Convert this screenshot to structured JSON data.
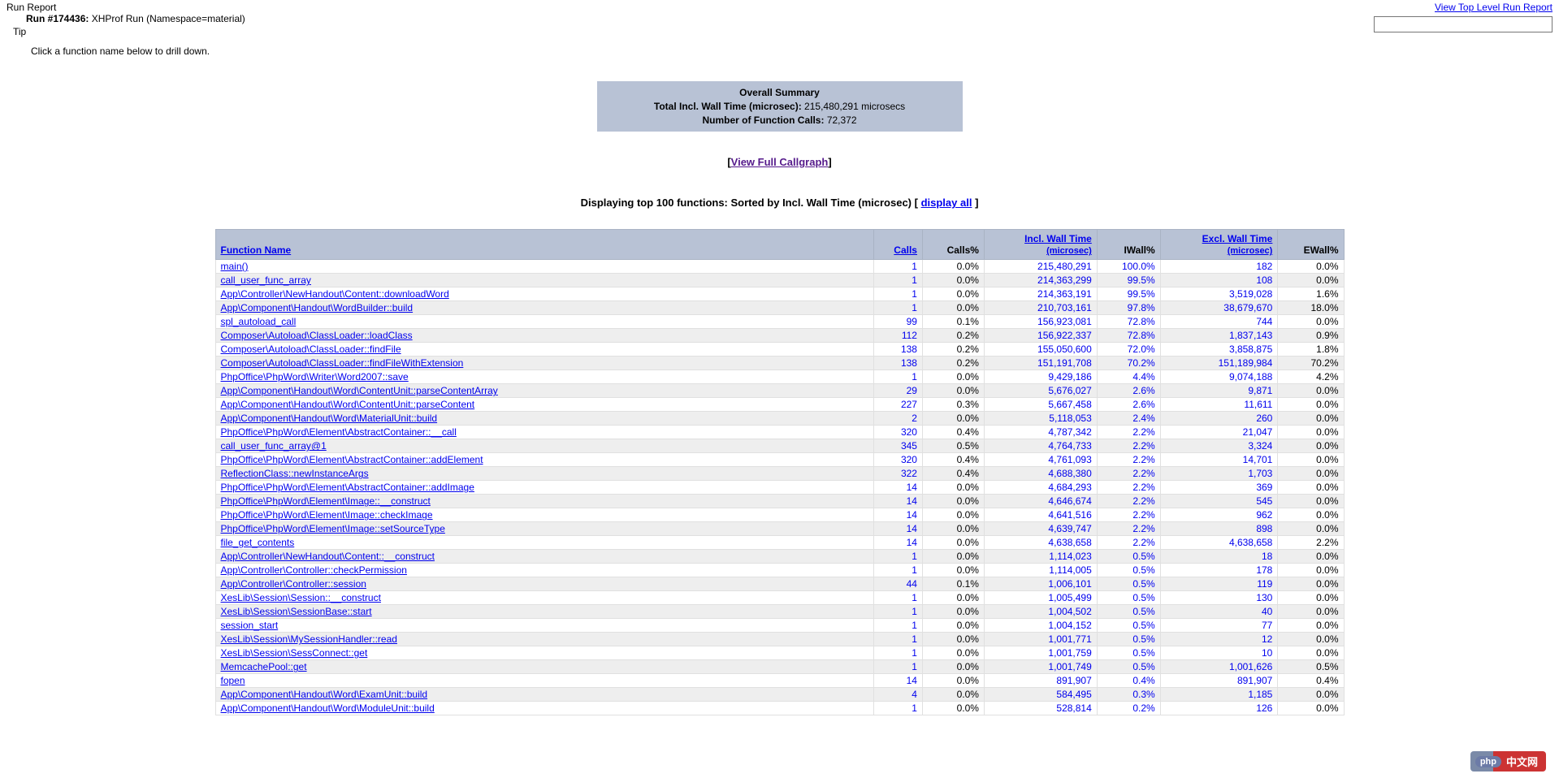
{
  "header": {
    "report_label": "Run Report",
    "run_prefix": "Run #174436:",
    "run_desc": "XHProf Run (Namespace=material)",
    "tip_label": "Tip",
    "tip_text": "Click a function name below to drill down.",
    "top_link": "View Top Level Run Report"
  },
  "summary": {
    "title": "Overall Summary",
    "line1_label": "Total Incl. Wall Time (microsec):",
    "line1_value": "215,480,291 microsecs",
    "line2_label": "Number of Function Calls:",
    "line2_value": "72,372"
  },
  "callgraph": {
    "open": "[",
    "text": "View Full Callgraph",
    "close": "]"
  },
  "heading": {
    "text": "Displaying top 100 functions: Sorted by Incl. Wall Time (microsec)",
    "link_open": " [ ",
    "link_text": "display all",
    "link_close": " ]"
  },
  "columns": {
    "fname": "Function Name",
    "calls": "Calls",
    "calls_pct": "Calls%",
    "iwt": "Incl. Wall Time",
    "iwt_sub": "(microsec)",
    "iwall_pct": "IWall%",
    "ewt": "Excl. Wall Time",
    "ewt_sub": "(microsec)",
    "ewall_pct": "EWall%"
  },
  "rows": [
    {
      "fn": "main()",
      "calls": "1",
      "calls_pct": "0.0%",
      "iwt": "215,480,291",
      "iwall": "100.0%",
      "ewt": "182",
      "ewall": "0.0%"
    },
    {
      "fn": "call_user_func_array",
      "calls": "1",
      "calls_pct": "0.0%",
      "iwt": "214,363,299",
      "iwall": "99.5%",
      "ewt": "108",
      "ewall": "0.0%"
    },
    {
      "fn": "App\\Controller\\NewHandout\\Content::downloadWord",
      "calls": "1",
      "calls_pct": "0.0%",
      "iwt": "214,363,191",
      "iwall": "99.5%",
      "ewt": "3,519,028",
      "ewall": "1.6%"
    },
    {
      "fn": "App\\Component\\Handout\\WordBuilder::build",
      "calls": "1",
      "calls_pct": "0.0%",
      "iwt": "210,703,161",
      "iwall": "97.8%",
      "ewt": "38,679,670",
      "ewall": "18.0%"
    },
    {
      "fn": "spl_autoload_call",
      "calls": "99",
      "calls_pct": "0.1%",
      "iwt": "156,923,081",
      "iwall": "72.8%",
      "ewt": "744",
      "ewall": "0.0%"
    },
    {
      "fn": "Composer\\Autoload\\ClassLoader::loadClass",
      "calls": "112",
      "calls_pct": "0.2%",
      "iwt": "156,922,337",
      "iwall": "72.8%",
      "ewt": "1,837,143",
      "ewall": "0.9%"
    },
    {
      "fn": "Composer\\Autoload\\ClassLoader::findFile",
      "calls": "138",
      "calls_pct": "0.2%",
      "iwt": "155,050,600",
      "iwall": "72.0%",
      "ewt": "3,858,875",
      "ewall": "1.8%"
    },
    {
      "fn": "Composer\\Autoload\\ClassLoader::findFileWithExtension",
      "calls": "138",
      "calls_pct": "0.2%",
      "iwt": "151,191,708",
      "iwall": "70.2%",
      "ewt": "151,189,984",
      "ewall": "70.2%"
    },
    {
      "fn": "PhpOffice\\PhpWord\\Writer\\Word2007::save",
      "calls": "1",
      "calls_pct": "0.0%",
      "iwt": "9,429,186",
      "iwall": "4.4%",
      "ewt": "9,074,188",
      "ewall": "4.2%"
    },
    {
      "fn": "App\\Component\\Handout\\Word\\ContentUnit::parseContentArray",
      "calls": "29",
      "calls_pct": "0.0%",
      "iwt": "5,676,027",
      "iwall": "2.6%",
      "ewt": "9,871",
      "ewall": "0.0%"
    },
    {
      "fn": "App\\Component\\Handout\\Word\\ContentUnit::parseContent",
      "calls": "227",
      "calls_pct": "0.3%",
      "iwt": "5,667,458",
      "iwall": "2.6%",
      "ewt": "11,611",
      "ewall": "0.0%"
    },
    {
      "fn": "App\\Component\\Handout\\Word\\MaterialUnit::build",
      "calls": "2",
      "calls_pct": "0.0%",
      "iwt": "5,118,053",
      "iwall": "2.4%",
      "ewt": "260",
      "ewall": "0.0%"
    },
    {
      "fn": "PhpOffice\\PhpWord\\Element\\AbstractContainer::__call",
      "calls": "320",
      "calls_pct": "0.4%",
      "iwt": "4,787,342",
      "iwall": "2.2%",
      "ewt": "21,047",
      "ewall": "0.0%"
    },
    {
      "fn": "call_user_func_array@1",
      "calls": "345",
      "calls_pct": "0.5%",
      "iwt": "4,764,733",
      "iwall": "2.2%",
      "ewt": "3,324",
      "ewall": "0.0%"
    },
    {
      "fn": "PhpOffice\\PhpWord\\Element\\AbstractContainer::addElement",
      "calls": "320",
      "calls_pct": "0.4%",
      "iwt": "4,761,093",
      "iwall": "2.2%",
      "ewt": "14,701",
      "ewall": "0.0%"
    },
    {
      "fn": "ReflectionClass::newInstanceArgs",
      "calls": "322",
      "calls_pct": "0.4%",
      "iwt": "4,688,380",
      "iwall": "2.2%",
      "ewt": "1,703",
      "ewall": "0.0%"
    },
    {
      "fn": "PhpOffice\\PhpWord\\Element\\AbstractContainer::addImage",
      "calls": "14",
      "calls_pct": "0.0%",
      "iwt": "4,684,293",
      "iwall": "2.2%",
      "ewt": "369",
      "ewall": "0.0%"
    },
    {
      "fn": "PhpOffice\\PhpWord\\Element\\Image::__construct",
      "calls": "14",
      "calls_pct": "0.0%",
      "iwt": "4,646,674",
      "iwall": "2.2%",
      "ewt": "545",
      "ewall": "0.0%"
    },
    {
      "fn": "PhpOffice\\PhpWord\\Element\\Image::checkImage",
      "calls": "14",
      "calls_pct": "0.0%",
      "iwt": "4,641,516",
      "iwall": "2.2%",
      "ewt": "962",
      "ewall": "0.0%"
    },
    {
      "fn": "PhpOffice\\PhpWord\\Element\\Image::setSourceType",
      "calls": "14",
      "calls_pct": "0.0%",
      "iwt": "4,639,747",
      "iwall": "2.2%",
      "ewt": "898",
      "ewall": "0.0%"
    },
    {
      "fn": "file_get_contents",
      "calls": "14",
      "calls_pct": "0.0%",
      "iwt": "4,638,658",
      "iwall": "2.2%",
      "ewt": "4,638,658",
      "ewall": "2.2%"
    },
    {
      "fn": "App\\Controller\\NewHandout\\Content::__construct",
      "calls": "1",
      "calls_pct": "0.0%",
      "iwt": "1,114,023",
      "iwall": "0.5%",
      "ewt": "18",
      "ewall": "0.0%"
    },
    {
      "fn": "App\\Controller\\Controller::checkPermission",
      "calls": "1",
      "calls_pct": "0.0%",
      "iwt": "1,114,005",
      "iwall": "0.5%",
      "ewt": "178",
      "ewall": "0.0%"
    },
    {
      "fn": "App\\Controller\\Controller::session",
      "calls": "44",
      "calls_pct": "0.1%",
      "iwt": "1,006,101",
      "iwall": "0.5%",
      "ewt": "119",
      "ewall": "0.0%"
    },
    {
      "fn": "XesLib\\Session\\Session::__construct",
      "calls": "1",
      "calls_pct": "0.0%",
      "iwt": "1,005,499",
      "iwall": "0.5%",
      "ewt": "130",
      "ewall": "0.0%"
    },
    {
      "fn": "XesLib\\Session\\SessionBase::start",
      "calls": "1",
      "calls_pct": "0.0%",
      "iwt": "1,004,502",
      "iwall": "0.5%",
      "ewt": "40",
      "ewall": "0.0%"
    },
    {
      "fn": "session_start",
      "calls": "1",
      "calls_pct": "0.0%",
      "iwt": "1,004,152",
      "iwall": "0.5%",
      "ewt": "77",
      "ewall": "0.0%"
    },
    {
      "fn": "XesLib\\Session\\MySessionHandler::read",
      "calls": "1",
      "calls_pct": "0.0%",
      "iwt": "1,001,771",
      "iwall": "0.5%",
      "ewt": "12",
      "ewall": "0.0%"
    },
    {
      "fn": "XesLib\\Session\\SessConnect::get",
      "calls": "1",
      "calls_pct": "0.0%",
      "iwt": "1,001,759",
      "iwall": "0.5%",
      "ewt": "10",
      "ewall": "0.0%"
    },
    {
      "fn": "MemcachePool::get",
      "calls": "1",
      "calls_pct": "0.0%",
      "iwt": "1,001,749",
      "iwall": "0.5%",
      "ewt": "1,001,626",
      "ewall": "0.5%"
    },
    {
      "fn": "fopen",
      "calls": "14",
      "calls_pct": "0.0%",
      "iwt": "891,907",
      "iwall": "0.4%",
      "ewt": "891,907",
      "ewall": "0.4%"
    },
    {
      "fn": "App\\Component\\Handout\\Word\\ExamUnit::build",
      "calls": "4",
      "calls_pct": "0.0%",
      "iwt": "584,495",
      "iwall": "0.3%",
      "ewt": "1,185",
      "ewall": "0.0%"
    },
    {
      "fn": "App\\Component\\Handout\\Word\\ModuleUnit::build",
      "calls": "1",
      "calls_pct": "0.0%",
      "iwt": "528,814",
      "iwall": "0.2%",
      "ewt": "126",
      "ewall": "0.0%"
    }
  ],
  "watermark": {
    "php": "php",
    "text": "中文网"
  }
}
